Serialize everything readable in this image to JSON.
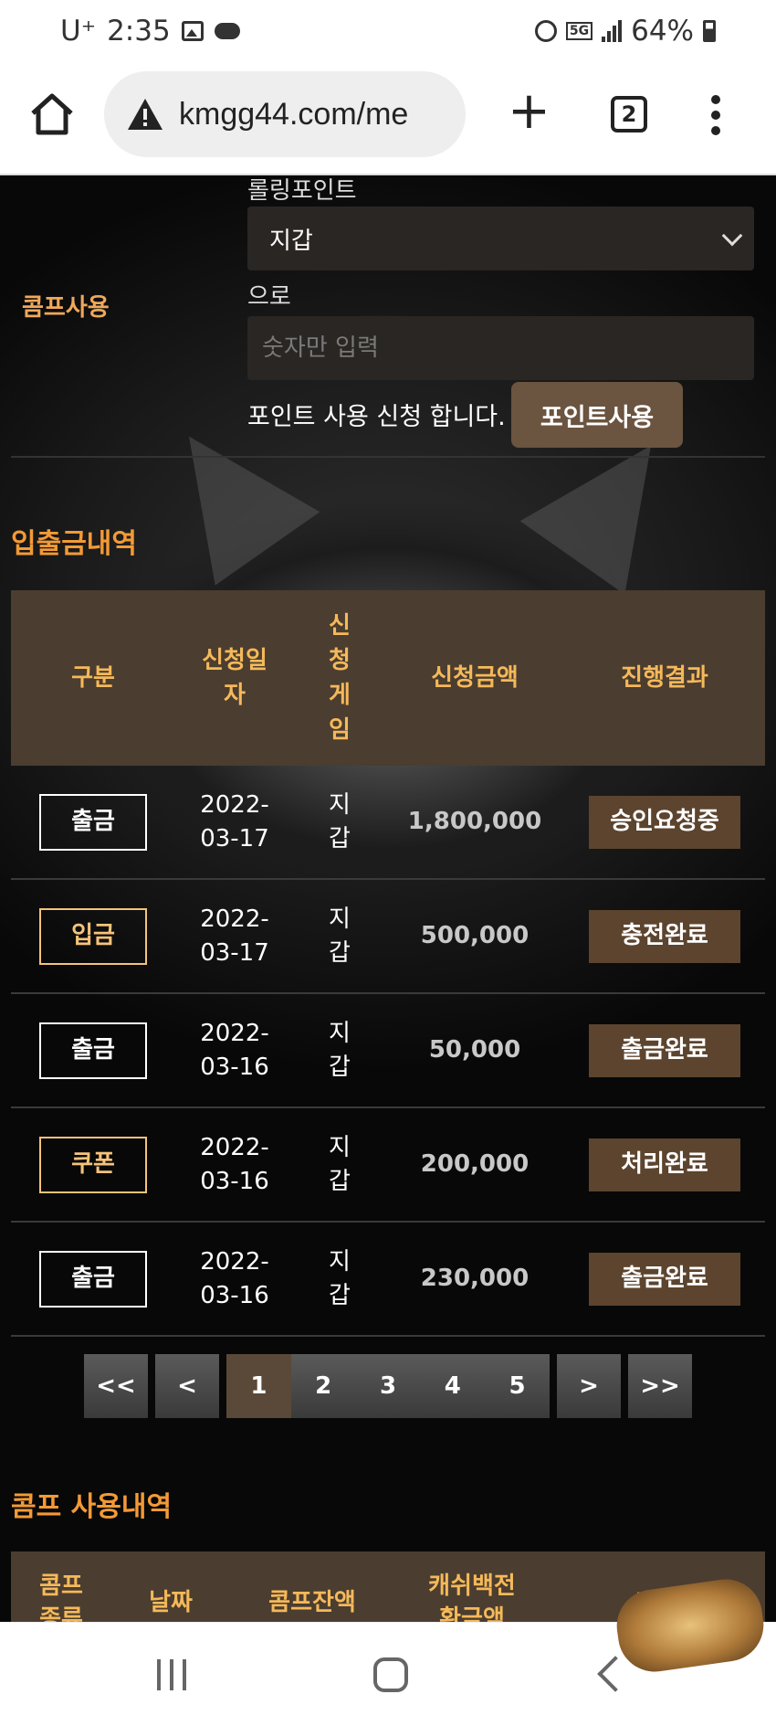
{
  "status_bar": {
    "carrier": "U⁺",
    "time": "2:35",
    "network": "5G",
    "battery": "64%"
  },
  "browser": {
    "url": "kmgg44.com/me",
    "tab_count": "2"
  },
  "point_form": {
    "rolling_label": "롤링포인트",
    "wallet_select": "지갑",
    "comp_label": "콤프사용",
    "to_label": "으로",
    "amount_placeholder": "숫자만 입력",
    "apply_text": "포인트 사용 신청 합니다.",
    "apply_button": "포인트사용"
  },
  "history": {
    "title": "입출금내역",
    "headers": [
      "구분",
      "신청일\n자",
      "신\n청\n게\n임",
      "신청금액",
      "진행결과"
    ],
    "rows": [
      {
        "type": "출금",
        "date": "2022-\n03-17",
        "game": "지\n갑",
        "amount": "1,800,000",
        "result": "승인요청중"
      },
      {
        "type": "입금",
        "date": "2022-\n03-17",
        "game": "지\n갑",
        "amount": "500,000",
        "result": "충전완료"
      },
      {
        "type": "출금",
        "date": "2022-\n03-16",
        "game": "지\n갑",
        "amount": "50,000",
        "result": "출금완료"
      },
      {
        "type": "쿠폰",
        "date": "2022-\n03-16",
        "game": "지\n갑",
        "amount": "200,000",
        "result": "처리완료"
      },
      {
        "type": "출금",
        "date": "2022-\n03-16",
        "game": "지\n갑",
        "amount": "230,000",
        "result": "출금완료"
      }
    ]
  },
  "pagination": {
    "first": "<<",
    "prev": "<",
    "pages": [
      "1",
      "2",
      "3",
      "4",
      "5"
    ],
    "active_page": "1",
    "next": ">",
    "last": ">>"
  },
  "comp_history": {
    "title": "콤프 사용내역",
    "headers": [
      "콤프\n종류",
      "날짜",
      "콤프잔액",
      "캐쉬백전\n환금액",
      "내역"
    ]
  },
  "colors": {
    "accent": "#f39a36",
    "header_bg": "#4b3d2f",
    "status_btn": "#5c442e"
  }
}
